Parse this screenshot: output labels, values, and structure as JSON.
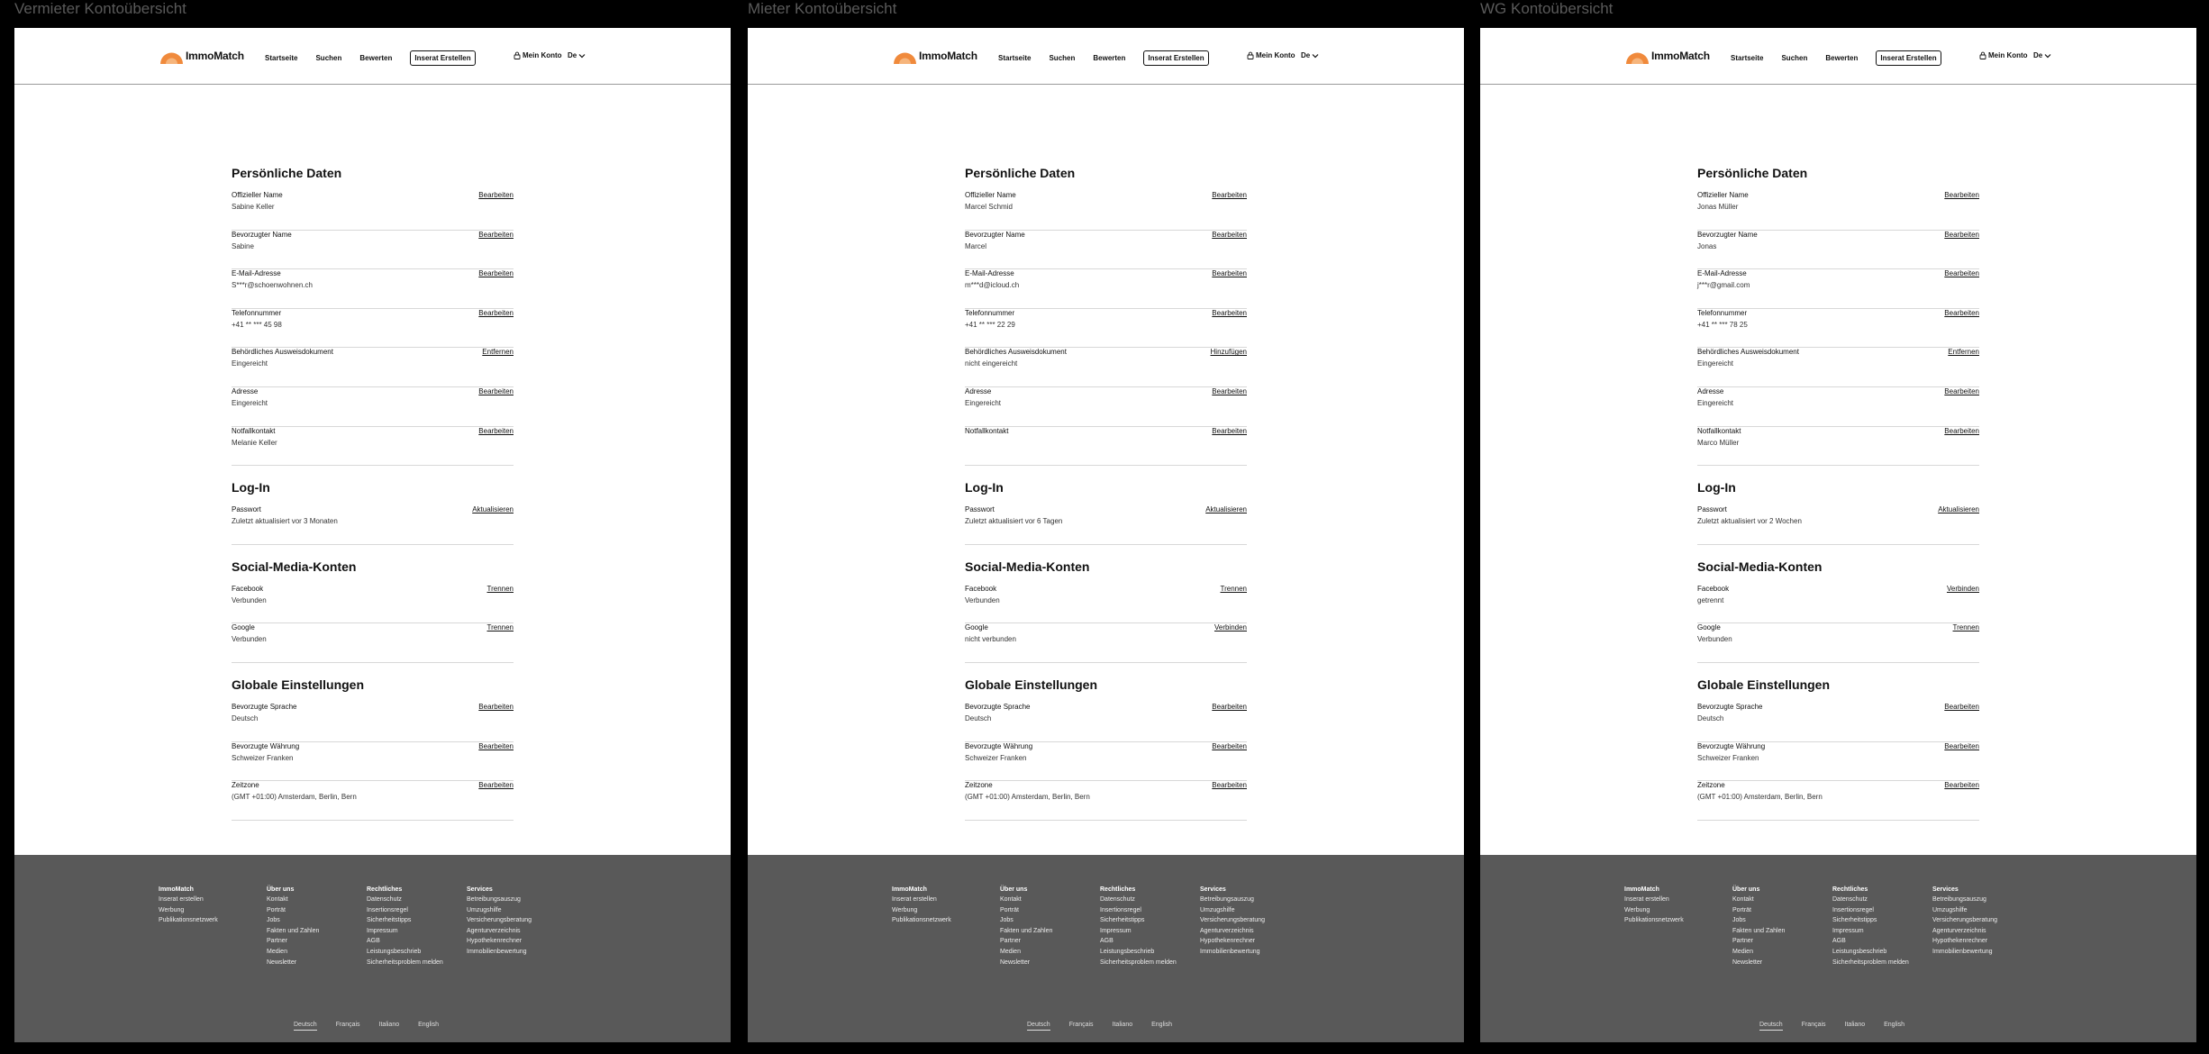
{
  "brand": {
    "name": "ImmoMatch",
    "logo_color": "#f08a3c"
  },
  "header": {
    "nav": [
      "Startseite",
      "Suchen",
      "Bewerten"
    ],
    "cta": "Inserat Erstellen",
    "account": "Mein Konto",
    "language": "De",
    "icons": [
      "lock-icon",
      "chevron-down-icon"
    ]
  },
  "sections": {
    "personal": "Persönliche Daten",
    "login": "Log-In",
    "social": "Social-Media-Konten",
    "global": "Globale Einstellungen"
  },
  "footer": {
    "columns": [
      {
        "title": "ImmoMatch",
        "links": [
          "Inserat erstellen",
          "Werbung",
          "Publikationsnetzwerk"
        ]
      },
      {
        "title": "Über uns",
        "links": [
          "Kontakt",
          "Porträt",
          "Jobs",
          "Fakten und Zahlen",
          "Partner",
          "Medien",
          "Newsletter"
        ]
      },
      {
        "title": "Rechtliches",
        "links": [
          "Datenschutz",
          "Insertionsregel",
          "Sicherheitstipps",
          "Impressum",
          "AGB",
          "Leistungsbeschrieb",
          "Sicherheitsproblem melden"
        ]
      },
      {
        "title": "Services",
        "links": [
          "Betreibungsauszug",
          "Umzugshilfe",
          "Versicherungsberatung",
          "Agenturverzeichnis",
          "Hypothekenrechner",
          "Immobilienbewertung"
        ]
      }
    ],
    "languages": [
      "Deutsch",
      "Français",
      "Italiano",
      "English"
    ],
    "active_language": "Deutsch"
  },
  "panels": [
    {
      "title": "Vermieter Kontoübersicht",
      "personal": [
        {
          "label": "Offizieller Name",
          "value": "Sabine Keller",
          "action": "Bearbeiten"
        },
        {
          "label": "Bevorzugter Name",
          "value": "Sabine",
          "action": "Bearbeiten"
        },
        {
          "label": "E-Mail-Adresse",
          "value": "S***r@schoenwohnen.ch",
          "action": "Bearbeiten"
        },
        {
          "label": "Telefonnummer",
          "value": "+41 ** *** 45 98",
          "action": "Bearbeiten"
        },
        {
          "label": "Behördliches Ausweisdokument",
          "value": "Eingereicht",
          "action": "Entfernen"
        },
        {
          "label": "Adresse",
          "value": "Eingereicht",
          "action": "Bearbeiten"
        },
        {
          "label": "Notfallkontakt",
          "value": "Melanie Keller",
          "action": "Bearbeiten"
        }
      ],
      "login": [
        {
          "label": "Passwort",
          "value": "Zuletzt aktualisiert vor 3 Monaten",
          "action": "Aktualisieren"
        }
      ],
      "social": [
        {
          "label": "Facebook",
          "value": "Verbunden",
          "action": "Trennen"
        },
        {
          "label": "Google",
          "value": "Verbunden",
          "action": "Trennen"
        }
      ],
      "global": [
        {
          "label": "Bevorzugte Sprache",
          "value": "Deutsch",
          "action": "Bearbeiten"
        },
        {
          "label": "Bevorzugte Währung",
          "value": "Schweizer Franken",
          "action": "Bearbeiten"
        },
        {
          "label": "Zeitzone",
          "value": "(GMT +01:00) Amsterdam, Berlin, Bern",
          "action": "Bearbeiten"
        }
      ]
    },
    {
      "title": "Mieter Kontoübersicht",
      "personal": [
        {
          "label": "Offizieller Name",
          "value": "Marcel Schmid",
          "action": "Bearbeiten"
        },
        {
          "label": "Bevorzugter Name",
          "value": "Marcel",
          "action": "Bearbeiten"
        },
        {
          "label": "E-Mail-Adresse",
          "value": "m***d@icloud.ch",
          "action": "Bearbeiten"
        },
        {
          "label": "Telefonnummer",
          "value": "+41 ** *** 22 29",
          "action": "Bearbeiten"
        },
        {
          "label": "Behördliches Ausweisdokument",
          "value": "nicht eingereicht",
          "action": "Hinzufügen"
        },
        {
          "label": "Adresse",
          "value": "Eingereicht",
          "action": "Bearbeiten"
        },
        {
          "label": "Notfallkontakt",
          "value": "",
          "action": "Bearbeiten"
        }
      ],
      "login": [
        {
          "label": "Passwort",
          "value": "Zuletzt aktualisiert vor 6 Tagen",
          "action": "Aktualisieren"
        }
      ],
      "social": [
        {
          "label": "Facebook",
          "value": "Verbunden",
          "action": "Trennen"
        },
        {
          "label": "Google",
          "value": "nicht verbunden",
          "action": "Verbinden"
        }
      ],
      "global": [
        {
          "label": "Bevorzugte Sprache",
          "value": "Deutsch",
          "action": "Bearbeiten"
        },
        {
          "label": "Bevorzugte Währung",
          "value": "Schweizer Franken",
          "action": "Bearbeiten"
        },
        {
          "label": "Zeitzone",
          "value": "(GMT +01:00) Amsterdam, Berlin, Bern",
          "action": "Bearbeiten"
        }
      ]
    },
    {
      "title": "WG Kontoübersicht",
      "personal": [
        {
          "label": "Offizieller Name",
          "value": "Jonas Müller",
          "action": "Bearbeiten"
        },
        {
          "label": "Bevorzugter Name",
          "value": "Jonas",
          "action": "Bearbeiten"
        },
        {
          "label": "E-Mail-Adresse",
          "value": "j***r@gmail.com",
          "action": "Bearbeiten"
        },
        {
          "label": "Telefonnummer",
          "value": "+41 ** *** 78 25",
          "action": "Bearbeiten"
        },
        {
          "label": "Behördliches Ausweisdokument",
          "value": "Eingereicht",
          "action": "Entfernen"
        },
        {
          "label": "Adresse",
          "value": "Eingereicht",
          "action": "Bearbeiten"
        },
        {
          "label": "Notfallkontakt",
          "value": "Marco Müller",
          "action": "Bearbeiten"
        }
      ],
      "login": [
        {
          "label": "Passwort",
          "value": "Zuletzt aktualisiert vor 2 Wochen",
          "action": "Aktualisieren"
        }
      ],
      "social": [
        {
          "label": "Facebook",
          "value": "getrennt",
          "action": "Verbinden"
        },
        {
          "label": "Google",
          "value": "Verbunden",
          "action": "Trennen"
        }
      ],
      "global": [
        {
          "label": "Bevorzugte Sprache",
          "value": "Deutsch",
          "action": "Bearbeiten"
        },
        {
          "label": "Bevorzugte Währung",
          "value": "Schweizer Franken",
          "action": "Bearbeiten"
        },
        {
          "label": "Zeitzone",
          "value": "(GMT +01:00) Amsterdam, Berlin, Bern",
          "action": "Bearbeiten"
        }
      ]
    }
  ]
}
